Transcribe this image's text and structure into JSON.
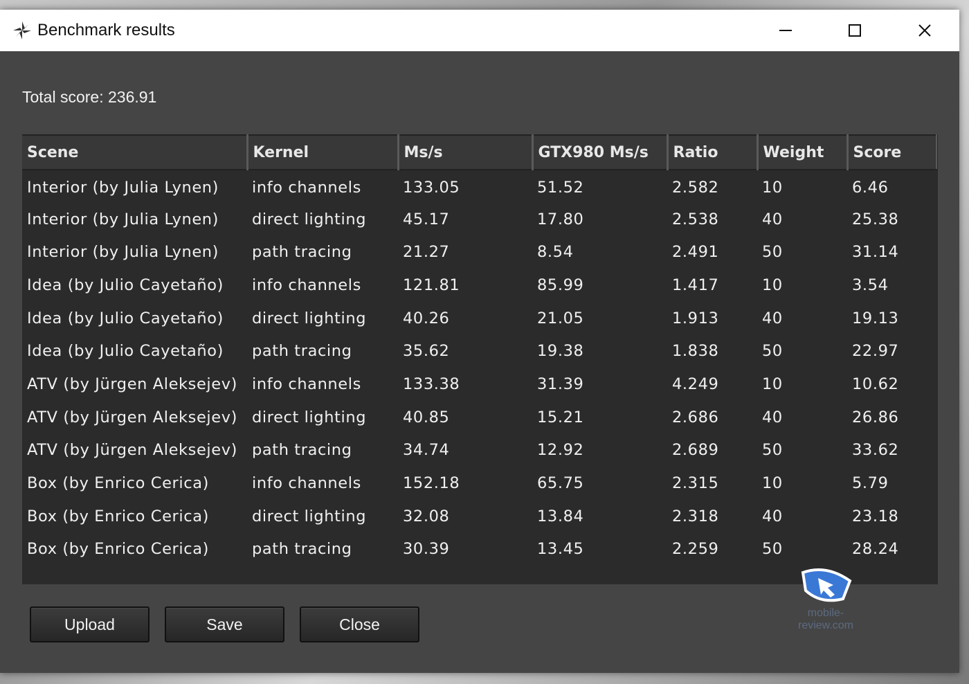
{
  "window": {
    "title": "Benchmark results",
    "controls": {
      "minimize": "minimize",
      "maximize": "maximize",
      "close": "close"
    }
  },
  "summary": {
    "total_score": "Total score: 236.91"
  },
  "table": {
    "columns": [
      "Scene",
      "Kernel",
      "Ms/s",
      "GTX980 Ms/s",
      "Ratio",
      "Weight",
      "Score"
    ],
    "rows": [
      [
        "Interior (by Julia Lynen)",
        "info channels",
        "133.05",
        "51.52",
        "2.582",
        "10",
        "6.46"
      ],
      [
        "Interior (by Julia Lynen)",
        "direct lighting",
        "45.17",
        "17.80",
        "2.538",
        "40",
        "25.38"
      ],
      [
        "Interior (by Julia Lynen)",
        "path tracing",
        "21.27",
        "8.54",
        "2.491",
        "50",
        "31.14"
      ],
      [
        "Idea (by Julio Cayetaño)",
        "info channels",
        "121.81",
        "85.99",
        "1.417",
        "10",
        "3.54"
      ],
      [
        "Idea (by Julio Cayetaño)",
        "direct lighting",
        "40.26",
        "21.05",
        "1.913",
        "40",
        "19.13"
      ],
      [
        "Idea (by Julio Cayetaño)",
        "path tracing",
        "35.62",
        "19.38",
        "1.838",
        "50",
        "22.97"
      ],
      [
        "ATV (by Jürgen Aleksejev)",
        "info channels",
        "133.38",
        "31.39",
        "4.249",
        "10",
        "10.62"
      ],
      [
        "ATV (by Jürgen Aleksejev)",
        "direct lighting",
        "40.85",
        "15.21",
        "2.686",
        "40",
        "26.86"
      ],
      [
        "ATV (by Jürgen Aleksejev)",
        "path tracing",
        "34.74",
        "12.92",
        "2.689",
        "50",
        "33.62"
      ],
      [
        "Box (by Enrico Cerica)",
        "info channels",
        "152.18",
        "65.75",
        "2.315",
        "10",
        "5.79"
      ],
      [
        "Box (by Enrico Cerica)",
        "direct lighting",
        "32.08",
        "13.84",
        "2.318",
        "40",
        "23.18"
      ],
      [
        "Box (by Enrico Cerica)",
        "path tracing",
        "30.39",
        "13.45",
        "2.259",
        "50",
        "28.24"
      ]
    ]
  },
  "buttons": {
    "upload": "Upload",
    "save": "Save",
    "close": "Close"
  },
  "watermark": {
    "text": "mobile-review.com"
  },
  "icons": {
    "app": "app-logo-icon",
    "minimize": "minimize-icon",
    "maximize": "maximize-icon",
    "close": "close-icon",
    "watermark": "watermark-logo-icon"
  }
}
